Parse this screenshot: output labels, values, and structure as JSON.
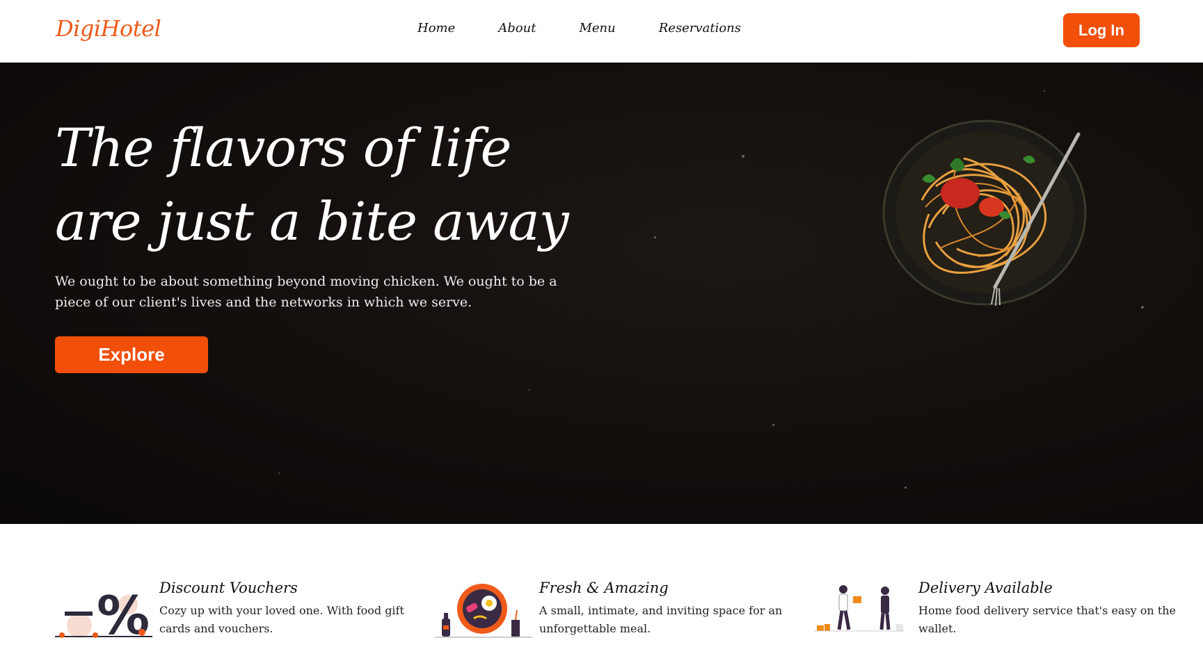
{
  "nav": {
    "logo": "DigiHotel",
    "links": [
      "Home",
      "About",
      "Menu",
      "Reservations"
    ],
    "login_label": "Log In"
  },
  "hero": {
    "title": "The flavors of life are just a bite away",
    "subtitle": "We ought to be about something beyond moving chicken. We ought to be a piece of our client's lives and the networks in which we serve.",
    "cta_label": "Explore"
  },
  "features": [
    {
      "icon": "discount-percent-icon",
      "title": "Discount Vouchers",
      "desc": "Cozy up with your loved one. With food gift cards and vouchers."
    },
    {
      "icon": "food-plate-icon",
      "title": "Fresh & Amazing",
      "desc": "A small, intimate, and inviting space for an unforgettable meal."
    },
    {
      "icon": "delivery-people-icon",
      "title": "Delivery Available",
      "desc": "Home food delivery service that's easy on the wallet."
    }
  ],
  "colors": {
    "accent": "#f24f0a",
    "logo": "#f05a1a",
    "hero_bg": "#120e0c"
  }
}
